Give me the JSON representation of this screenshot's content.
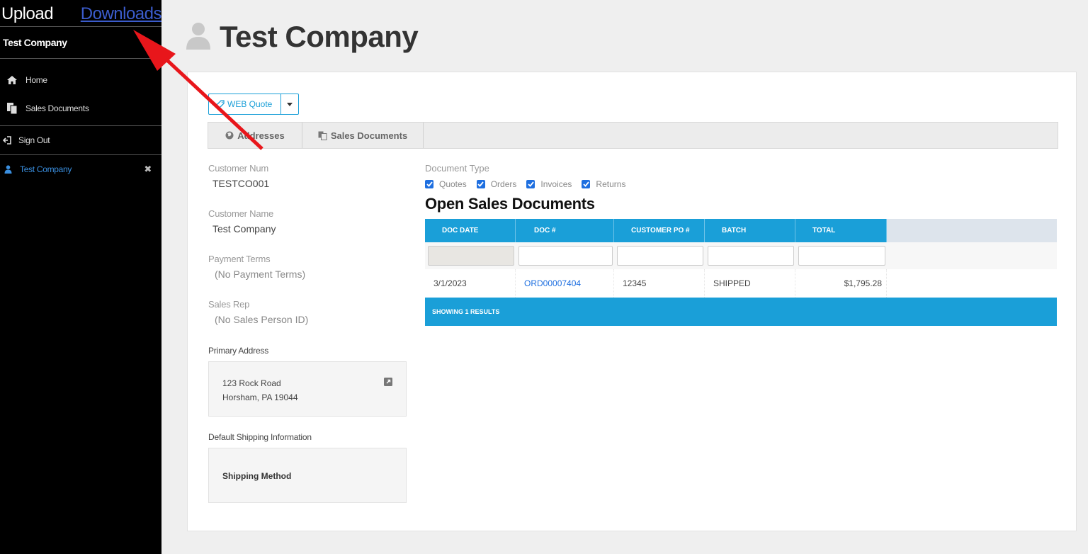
{
  "sidebar": {
    "app_title": "PO Upload",
    "downloads_link": "Downloads",
    "company": "Test Company",
    "nav": [
      {
        "label": "Home",
        "icon": "home-icon"
      },
      {
        "label": "Sales Documents",
        "icon": "copy-icon"
      },
      {
        "label": "Sign Out",
        "icon": "sign-out-icon"
      }
    ],
    "active_customer": "Test Company"
  },
  "header": {
    "title": "Test Company",
    "icon": "user-icon"
  },
  "toolbar": {
    "quote_button": "WEB Quote"
  },
  "tabs": [
    {
      "label": "Addresses",
      "icon": "globe-icon"
    },
    {
      "label": "Sales Documents",
      "icon": "copy-icon"
    }
  ],
  "customer": {
    "num_label": "Customer Num",
    "num": "TESTCO001",
    "name_label": "Customer Name",
    "name": "Test Company",
    "terms_label": "Payment Terms",
    "terms": "(No Payment Terms)",
    "rep_label": "Sales Rep",
    "rep": "(No Sales Person ID)",
    "primary_address_label": "Primary Address",
    "address_line1": "123 Rock Road",
    "address_line2": "Horsham, PA 19044",
    "shipping_label": "Default Shipping Information",
    "shipping_method_label": "Shipping Method"
  },
  "documents": {
    "type_label": "Document Type",
    "types": [
      {
        "label": "Quotes",
        "checked": true
      },
      {
        "label": "Orders",
        "checked": true
      },
      {
        "label": "Invoices",
        "checked": true
      },
      {
        "label": "Returns",
        "checked": true
      }
    ],
    "heading": "Open Sales Documents",
    "columns": [
      "DOC DATE",
      "DOC #",
      "CUSTOMER PO #",
      "BATCH",
      "TOTAL"
    ],
    "rows": [
      {
        "date": "3/1/2023",
        "doc": "ORD00007404",
        "po": "12345",
        "batch": "SHIPPED",
        "total": "$1,795.28"
      }
    ],
    "footer": "SHOWING 1 RESULTS"
  },
  "colors": {
    "accent": "#1a9fd8",
    "link": "#1e6fe0",
    "annotation_arrow": "#e8161b"
  }
}
